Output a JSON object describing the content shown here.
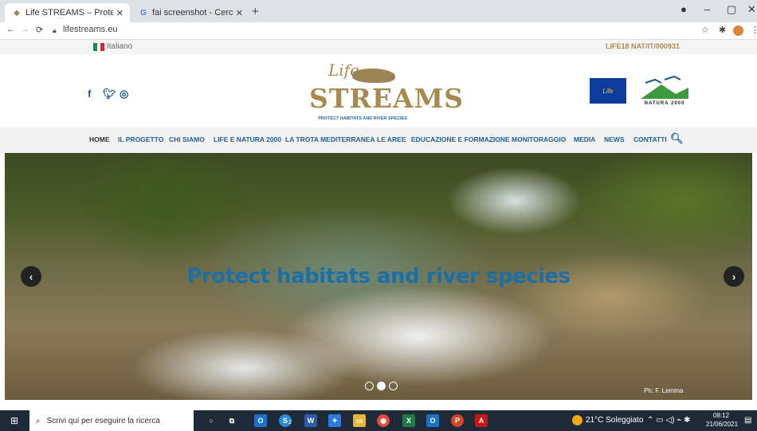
{
  "browser": {
    "tabs": [
      {
        "title": "Life STREAMS – Protect habitats",
        "icon": "fish-favicon",
        "active": true
      },
      {
        "title": "fai screenshot - Cerca con Googl",
        "icon": "google-g-icon",
        "active": false
      }
    ],
    "new_tab": "+",
    "url": "lifestreams.eu"
  },
  "site": {
    "language": "Italiano",
    "project_code": "LIFE18 NAT/IT/000931",
    "logo": {
      "life": "Life",
      "name": "STREAMS",
      "tagline": "PROTECT HABITATS AND RIVER SPECIES"
    },
    "eu_logo": "Life",
    "natura_logo": "NATURA 2000",
    "nav": [
      "HOME",
      "IL PROGETTO",
      "CHI SIAMO",
      "LIFE E NATURA 2000",
      "LA TROTA MEDITERRANEA",
      "LE AREE",
      "EDUCAZIONE E FORMAZIONE",
      "MONITORAGGIO",
      "MEDIA",
      "NEWS",
      "CONTATTI"
    ],
    "hero": {
      "title": "Protect habitats and river species",
      "credit": "Ph: F. Lemma",
      "slides": 3,
      "active_slide": 2
    }
  },
  "taskbar": {
    "search_placeholder": "Scrivi qui per eseguire la ricerca",
    "weather": "21°C Soleggiato",
    "time": "08:12",
    "date": "21/06/2021",
    "badge": "2"
  },
  "colors": {
    "brand_blue": "#1f5f96",
    "brand_gold": "#a98a4e",
    "taskbar": "#1f2a38"
  }
}
